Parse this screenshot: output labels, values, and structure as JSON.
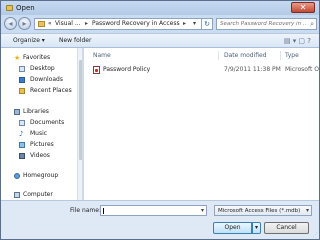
{
  "window": {
    "title": "Open",
    "close_glyph": "✕"
  },
  "address": {
    "crumbs": [
      "Visual ...",
      "Password Recovery in Access"
    ],
    "overflow": "«",
    "separator": "▸"
  },
  "search": {
    "placeholder": "Search Password Recovery in ..."
  },
  "toolbar": {
    "organize_label": "Organize ▾",
    "new_folder_label": "New folder"
  },
  "nav": {
    "favorites": "Favorites",
    "fav_items": [
      "Desktop",
      "Downloads",
      "Recent Places"
    ],
    "libraries": "Libraries",
    "lib_items": [
      "Documents",
      "Music",
      "Pictures",
      "Videos"
    ],
    "homegroup": "Homegroup",
    "computer": "Computer"
  },
  "files": {
    "columns": [
      "Name",
      "Date modified",
      "Type"
    ],
    "rows": [
      {
        "name": "Password Policy",
        "date": "7/9/2011 11:38 PM",
        "type": "Microsoft Of"
      }
    ]
  },
  "footer": {
    "file_name_label": "File name:",
    "file_name_value": "",
    "filter_value": "Microsoft Access Files (*.mdb)",
    "open_label": "Open",
    "cancel_label": "Cancel"
  },
  "colors": {
    "accent": "#3c7fb1",
    "frame": "#c9dcf1"
  }
}
